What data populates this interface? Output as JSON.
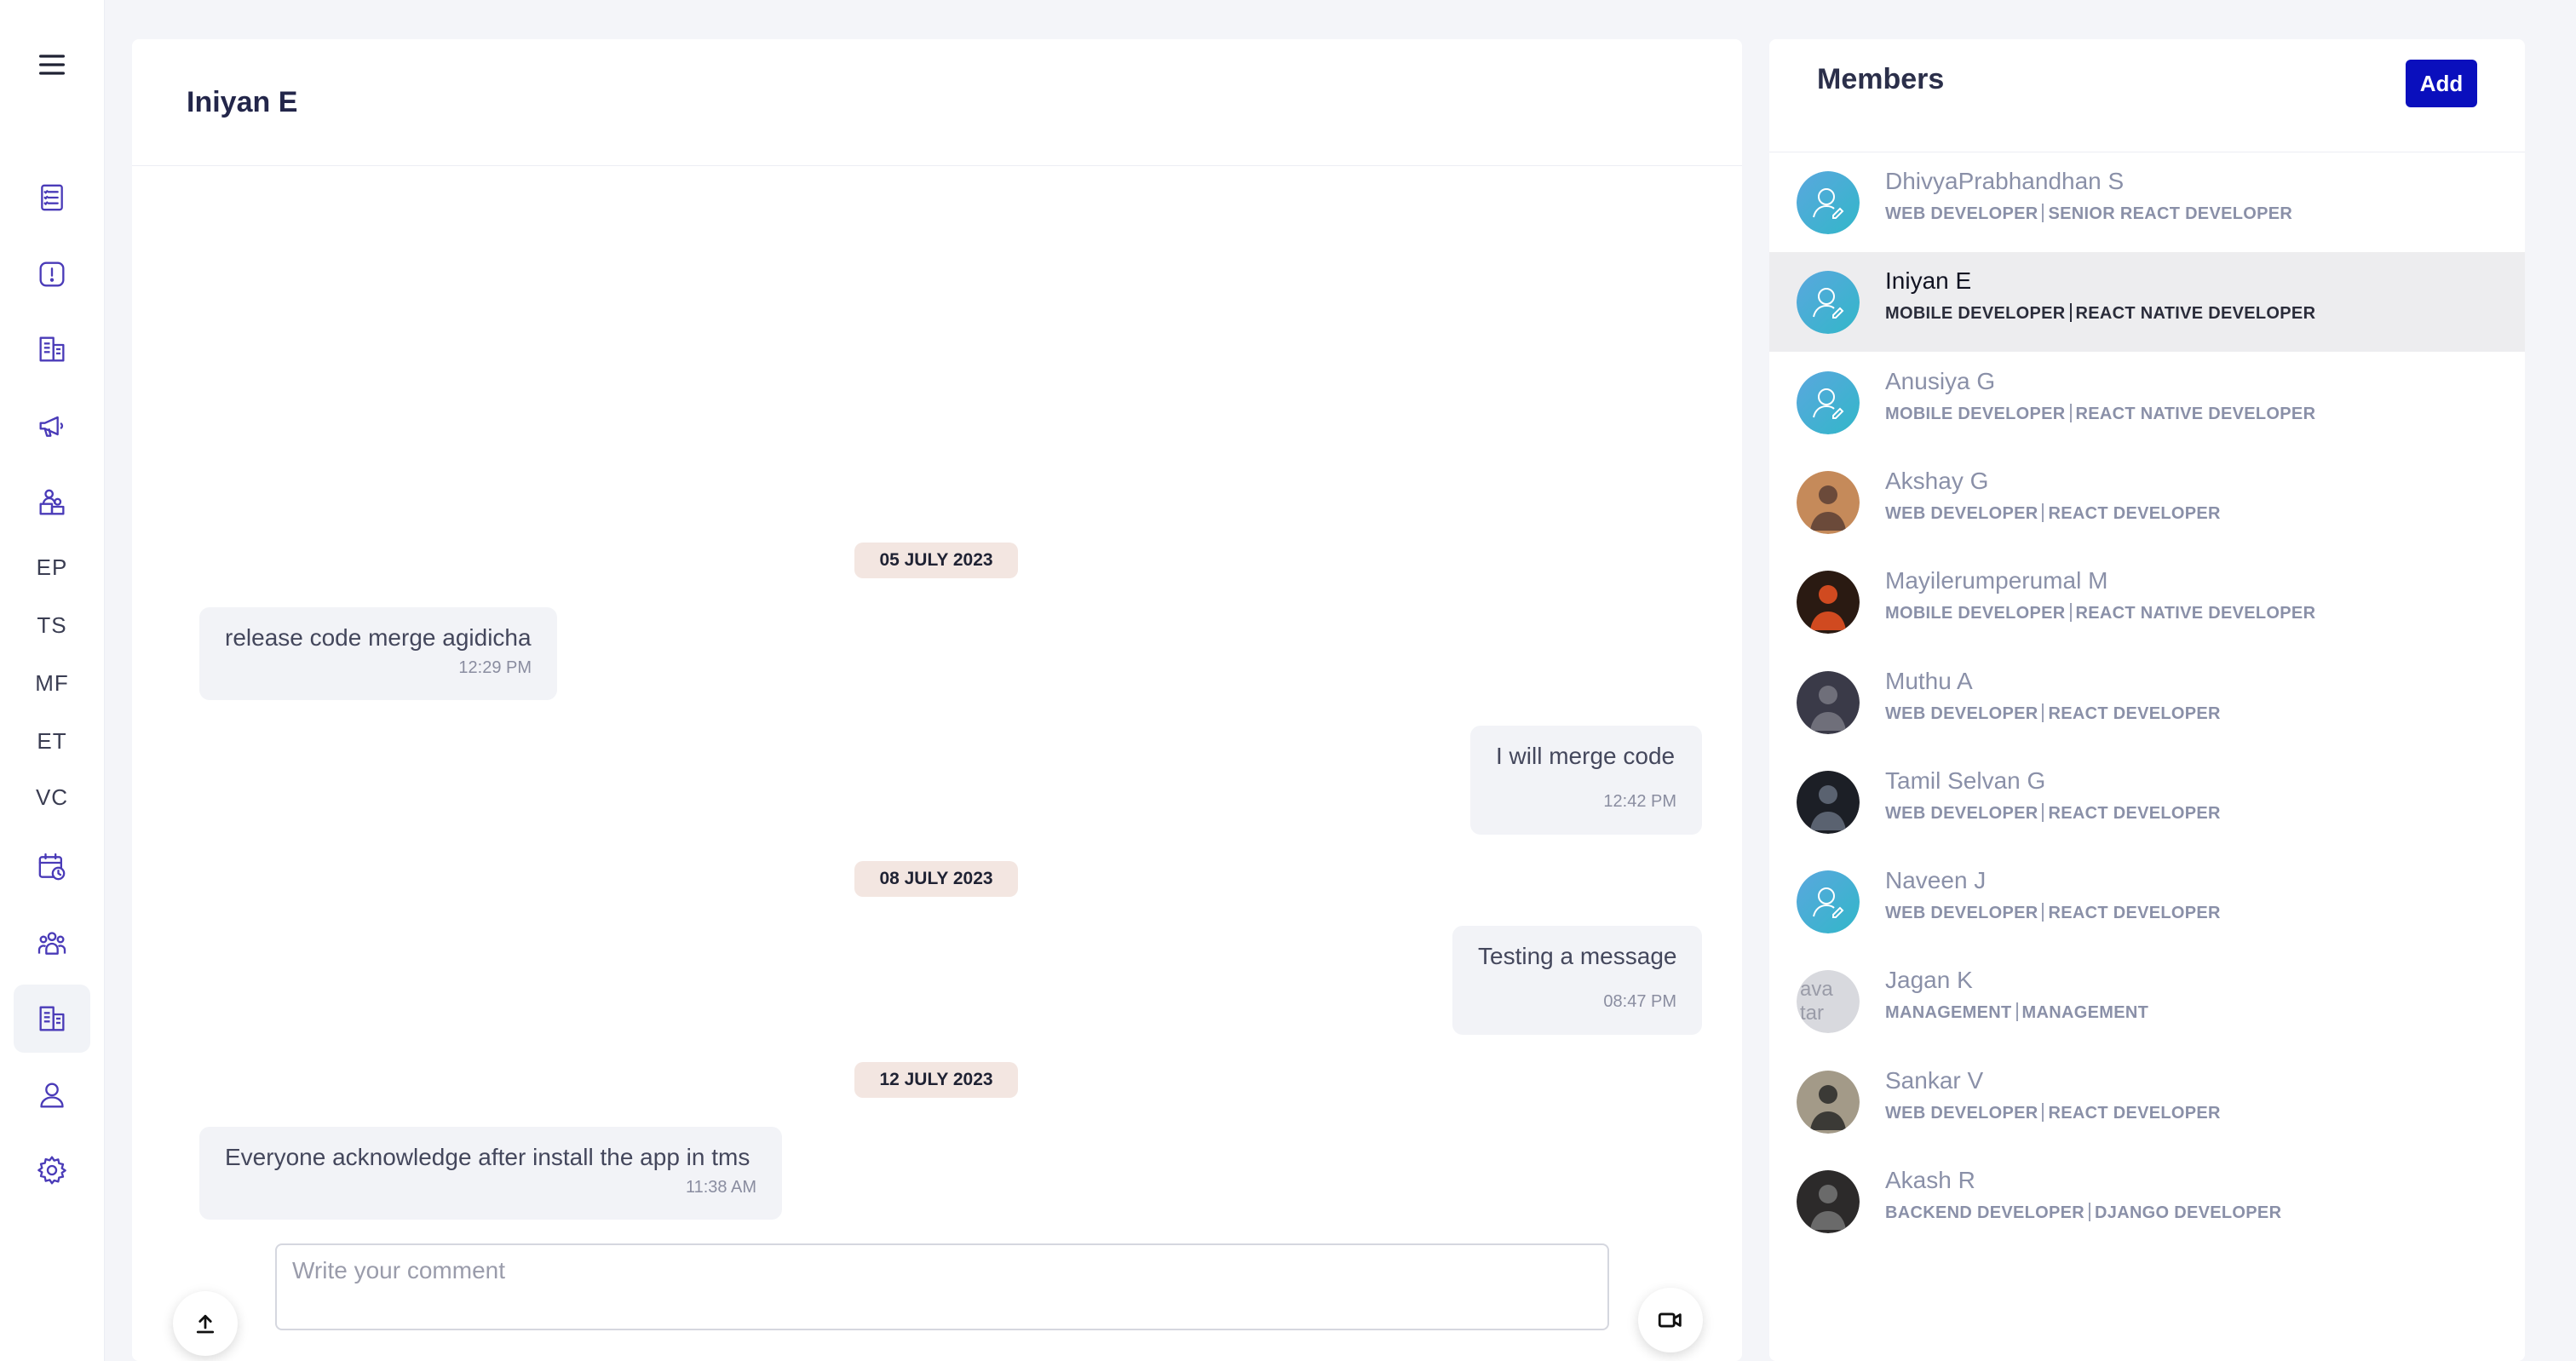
{
  "sidebar": {
    "icons": [
      "menu-icon",
      "clipboard-list-icon",
      "alert-icon",
      "building-icon",
      "megaphone-icon",
      "workers-icon",
      "calendar-clock-icon",
      "team-icon",
      "office-icon",
      "user-icon",
      "gear-icon"
    ],
    "text_items": [
      "EP",
      "TS",
      "MF",
      "ET",
      "VC"
    ]
  },
  "chat": {
    "title": "Iniyan E",
    "dates": [
      "05 JULY 2023",
      "08 JULY 2023",
      "12 JULY 2023"
    ],
    "messages": [
      {
        "text": "release code merge agidicha",
        "time": "12:29 PM",
        "direction": "incoming"
      },
      {
        "text": "I will merge code",
        "time": "12:42 PM",
        "direction": "outgoing"
      },
      {
        "text": "Testing a message",
        "time": "08:47 PM",
        "direction": "outgoing"
      },
      {
        "text": "Everyone acknowledge after install the app in tms",
        "time": "11:38 AM",
        "direction": "incoming"
      }
    ],
    "composer": {
      "placeholder": "Write your comment",
      "value": ""
    }
  },
  "members": {
    "title": "Members",
    "add_label": "Add",
    "list": [
      {
        "name": "DhivyaPrabhandhan S",
        "dept": "WEB DEVELOPER",
        "role": "SENIOR REACT DEVELOPER",
        "avatar": "default"
      },
      {
        "name": "Iniyan E",
        "dept": "MOBILE DEVELOPER",
        "role": "REACT NATIVE DEVELOPER",
        "avatar": "default",
        "selected": true
      },
      {
        "name": "Anusiya G",
        "dept": "MOBILE DEVELOPER",
        "role": "REACT NATIVE DEVELOPER",
        "avatar": "default"
      },
      {
        "name": "Akshay G",
        "dept": "WEB DEVELOPER",
        "role": "REACT DEVELOPER",
        "avatar": "photo"
      },
      {
        "name": "Mayilerumperumal M",
        "dept": "MOBILE DEVELOPER",
        "role": "REACT NATIVE DEVELOPER",
        "avatar": "photo"
      },
      {
        "name": "Muthu A",
        "dept": "WEB DEVELOPER",
        "role": "REACT DEVELOPER",
        "avatar": "photo"
      },
      {
        "name": "Tamil Selvan G",
        "dept": "WEB DEVELOPER",
        "role": "REACT DEVELOPER",
        "avatar": "photo"
      },
      {
        "name": "Naveen J",
        "dept": "WEB DEVELOPER",
        "role": "REACT DEVELOPER",
        "avatar": "default"
      },
      {
        "name": "Jagan K",
        "dept": "MANAGEMENT",
        "role": "MANAGEMENT",
        "avatar": "broken",
        "alt": "avatar"
      },
      {
        "name": "Sankar V",
        "dept": "WEB DEVELOPER",
        "role": "REACT DEVELOPER",
        "avatar": "photo"
      },
      {
        "name": "Akash R",
        "dept": "BACKEND DEVELOPER",
        "role": "DJANGO DEVELOPER",
        "avatar": "photo"
      }
    ]
  },
  "colors": {
    "accent": "#0a0fbd",
    "icon": "#4a3bb8",
    "date_chip": "#f3e6e1",
    "bubble": "#f2f3f7"
  }
}
